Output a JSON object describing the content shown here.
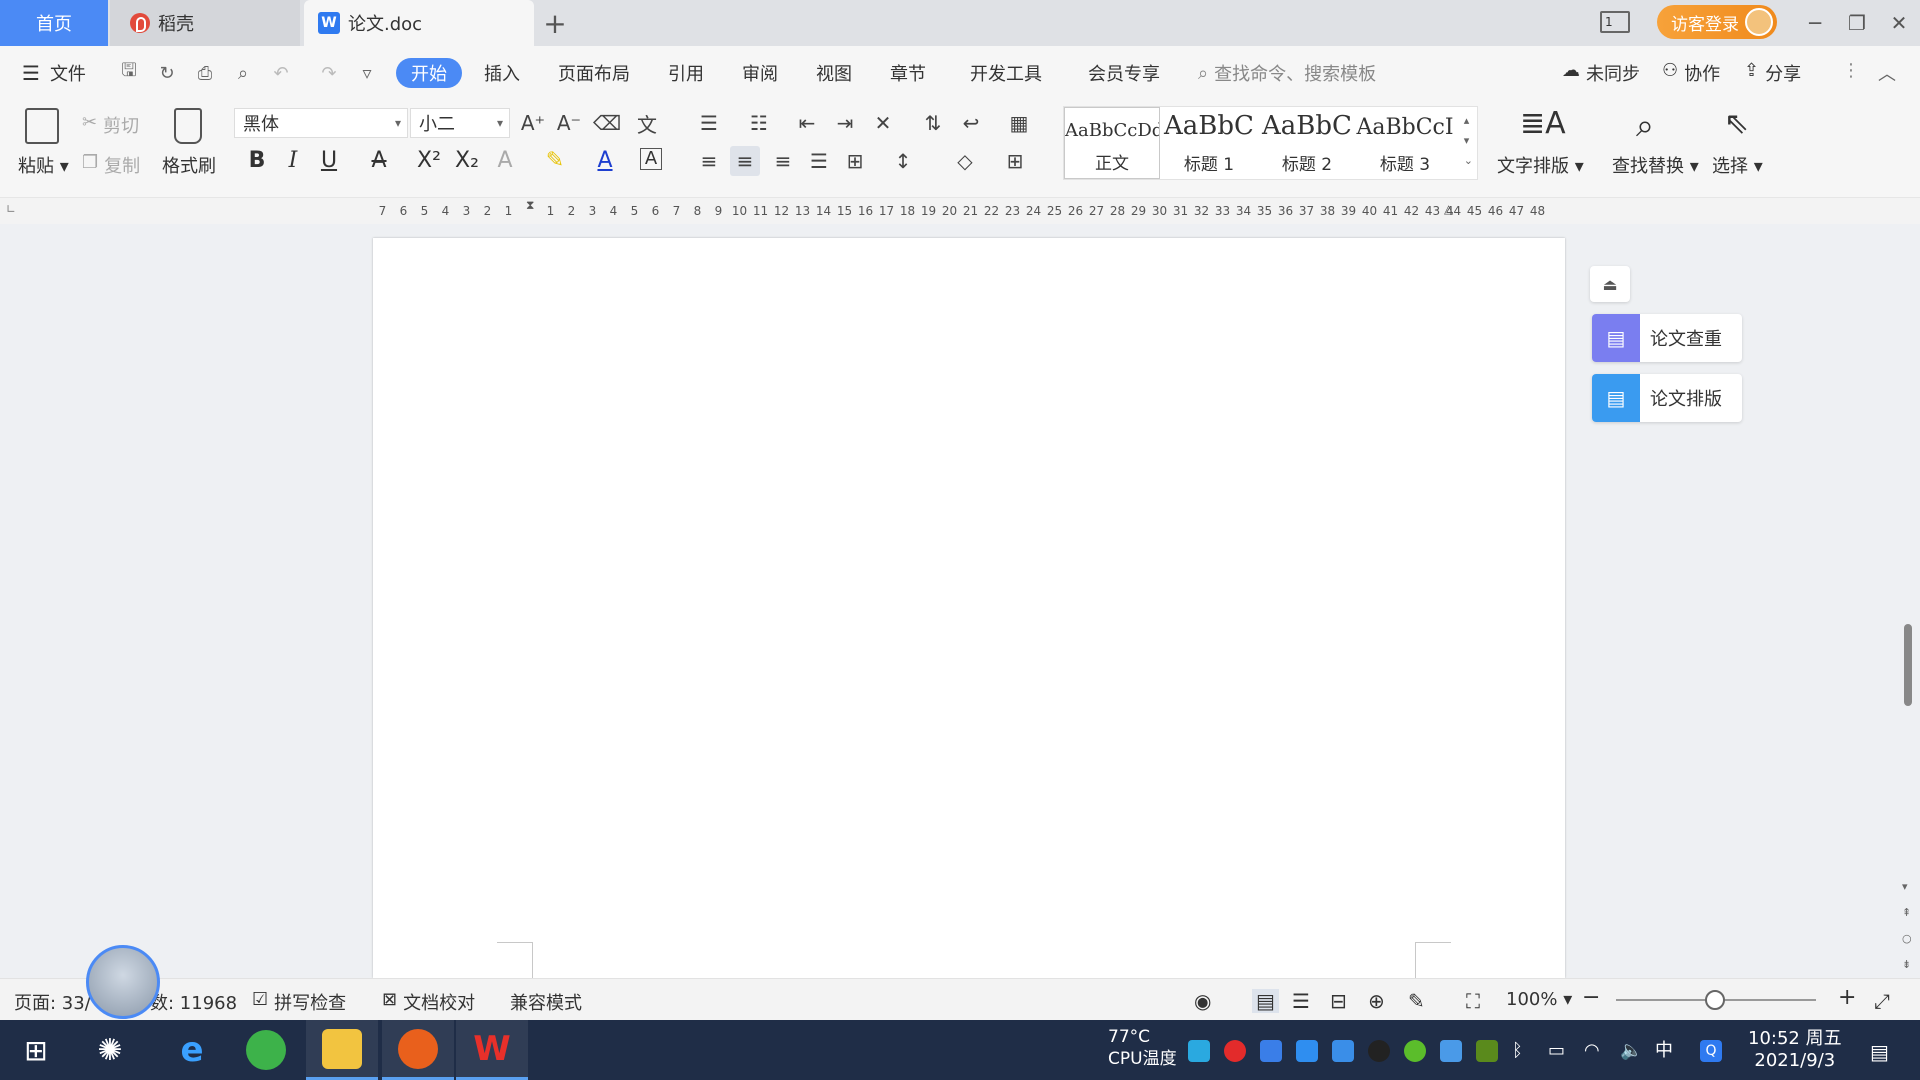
{
  "tabs": {
    "home": "首页",
    "daoke": "稻壳",
    "doc": "论文.doc",
    "add": "+"
  },
  "window": {
    "login": "访客登录"
  },
  "menu": {
    "file": "文件",
    "items": [
      "开始",
      "插入",
      "页面布局",
      "引用",
      "审阅",
      "视图",
      "章节",
      "开发工具",
      "会员专享"
    ],
    "search_placeholder": "查找命令、搜索模板",
    "sync": "未同步",
    "collab": "协作",
    "share": "分享"
  },
  "ribbon": {
    "paste": "粘贴",
    "cut": "剪切",
    "copy": "复制",
    "format_painter": "格式刷",
    "font_name": "黑体",
    "font_size": "小二",
    "styles": [
      {
        "sample": "AaBbCcDd",
        "name": "正文"
      },
      {
        "sample": "AaBbC",
        "name": "标题 1"
      },
      {
        "sample": "AaBbC",
        "name": "标题 2"
      },
      {
        "sample": "AaBbCcI",
        "name": "标题 3"
      }
    ],
    "text_layout": "文字排版",
    "find_replace": "查找替换",
    "select": "选择"
  },
  "ruler": {
    "ticks": [
      "7",
      "6",
      "5",
      "4",
      "3",
      "2",
      "1",
      "",
      "1",
      "2",
      "3",
      "4",
      "5",
      "6",
      "7",
      "8",
      "9",
      "10",
      "11",
      "12",
      "13",
      "14",
      "15",
      "16",
      "17",
      "18",
      "19",
      "20",
      "21",
      "22",
      "23",
      "24",
      "25",
      "26",
      "27",
      "28",
      "29",
      "30",
      "31",
      "32",
      "33",
      "34",
      "35",
      "36",
      "37",
      "38",
      "39",
      "40",
      "41",
      "42",
      "43",
      "44",
      "45",
      "46",
      "47",
      "48"
    ]
  },
  "side_panel": {
    "check": "论文查重",
    "layout": "论文排版"
  },
  "status": {
    "page": "页面: 33/",
    "words": "数: 11968",
    "spell": "拼写检查",
    "proof": "文档校对",
    "compat": "兼容模式",
    "zoom": "100%"
  },
  "taskbar": {
    "cpu_temp": "77°C",
    "cpu_label": "CPU温度",
    "ime": "中",
    "time": "10:52 周五",
    "date": "2021/9/3"
  },
  "colors": {
    "accent": "#4b8af5",
    "login": "#f08a1c",
    "taskbar": "#1f2d47"
  }
}
